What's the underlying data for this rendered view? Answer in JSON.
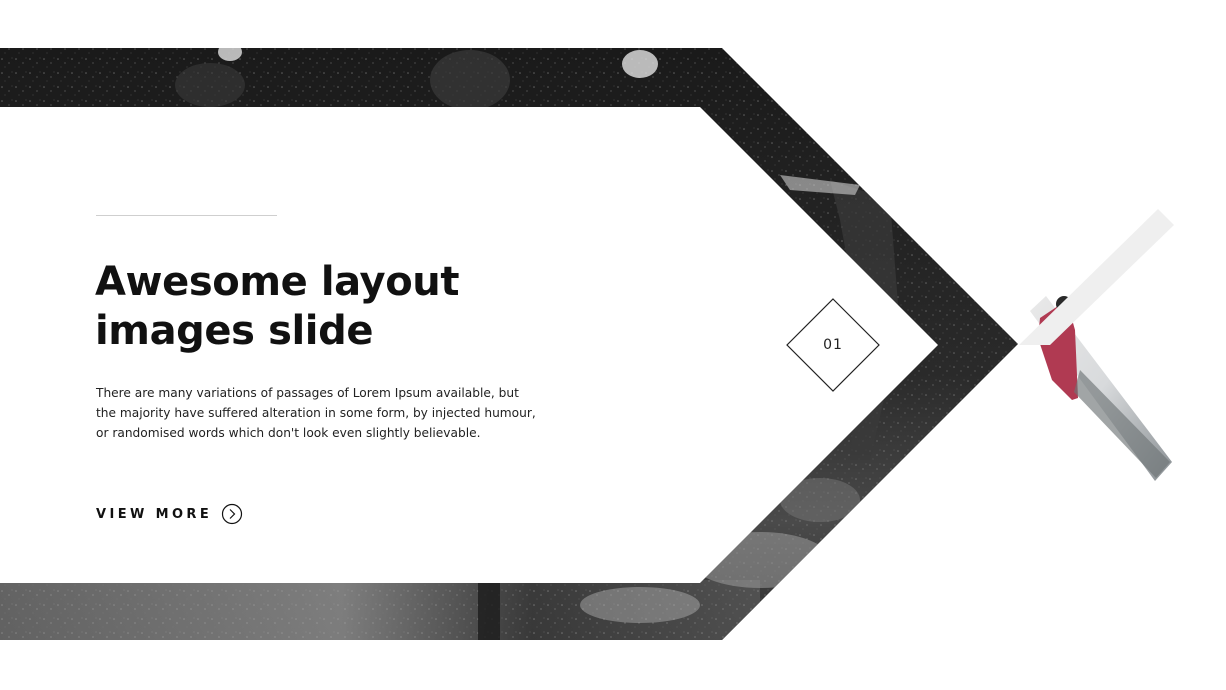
{
  "slide": {
    "title_line1": "Awesome layout",
    "title_line2": "images slide",
    "description": "There are many variations of passages of Lorem Ipsum available, but the majority have suffered alteration in some form, by injected humour, or randomised words which don't look even slightly believable.",
    "cta_label": "VIEW MORE",
    "slide_number": "01"
  },
  "icons": {
    "cta": "chevron-right-circle-icon",
    "badge": "diamond-outline-icon"
  },
  "colors": {
    "background": "#ffffff",
    "text": "#111111",
    "photo_dark": "#1c1c1c",
    "accent_jacket": "#b03a52",
    "divider": "#cfcfcf"
  }
}
